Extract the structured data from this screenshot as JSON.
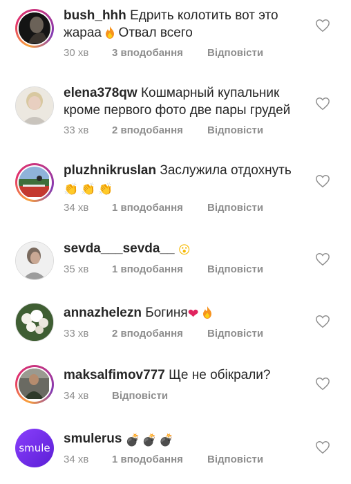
{
  "colors": {
    "text": "#262626",
    "meta": "#8e8e8e",
    "ring_start": "#f9a13a",
    "ring_end": "#833ab4",
    "heart_red": "#e0245e",
    "smule_purple": "#7b2ff7"
  },
  "meta_labels": {
    "reply": "Відповісти"
  },
  "comments": [
    {
      "username": "bush_hhh",
      "text": "Едрить колотить вот это жараа",
      "text_after": "Отвал всего",
      "time": "30 хв",
      "likes": "3 вподобання",
      "reply": "Відповісти"
    },
    {
      "username": "elena378qw",
      "text": "Кошмарный купальник кроме первого фото две пары грудей",
      "time": "33 хв",
      "likes": "2 вподобання",
      "reply": "Відповісти"
    },
    {
      "username": "pluzhnikruslan",
      "text": "Заслужила отдохнуть",
      "emojis": "👏👏👏",
      "time": "34 хв",
      "likes": "1 вподобання",
      "reply": "Відповісти"
    },
    {
      "username": "sevda___sevda__",
      "emojis": "😮",
      "time": "35 хв",
      "likes": "1 вподобання",
      "reply": "Відповісти"
    },
    {
      "username": "annazhelezn",
      "text": "Богиня",
      "emojis": "❤",
      "time": "33 хв",
      "likes": "2 вподобання",
      "reply": "Відповісти"
    },
    {
      "username": "maksalfimov777",
      "text": "Ще не обікрали?",
      "time": "34 хв",
      "reply": "Відповісти"
    },
    {
      "username": "smulerus",
      "emojis": "💣💣💣",
      "time": "34 хв",
      "likes": "1 вподобання",
      "reply": "Відповісти",
      "avatar_text": "smule"
    }
  ]
}
